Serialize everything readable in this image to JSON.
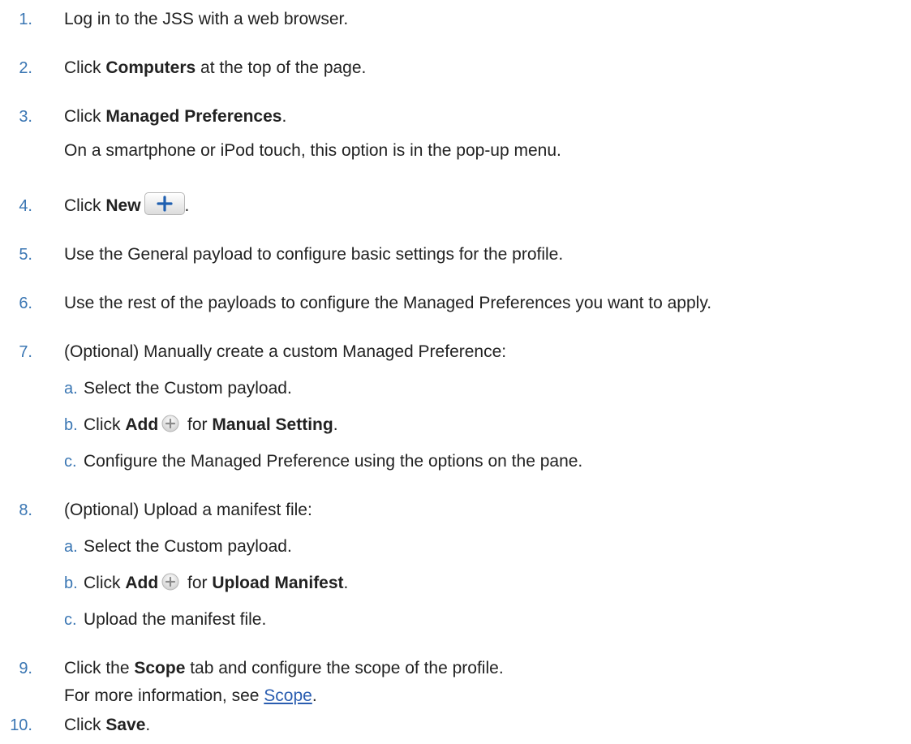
{
  "steps": [
    {
      "num": "1.",
      "text": "Log in to the JSS with a web browser."
    },
    {
      "num": "2.",
      "pre": "Click ",
      "bold": "Computers",
      "post": " at the top of the page."
    },
    {
      "num": "3.",
      "pre": "Click ",
      "bold": "Managed Preferences",
      "post": ".",
      "note": "On a smartphone or iPod touch, this option is in the pop-up menu."
    },
    {
      "num": "4.",
      "pre": "Click ",
      "bold": "New",
      "post": "."
    },
    {
      "num": "5.",
      "text": "Use the General payload to configure basic settings for the profile."
    },
    {
      "num": "6.",
      "text": "Use the rest of the payloads to configure the Managed Preferences you want to apply."
    },
    {
      "num": "7.",
      "text": "(Optional) Manually create a custom Managed Preference:",
      "sub": [
        {
          "num": "a.",
          "text": "Select the Custom payload."
        },
        {
          "num": "b.",
          "pre": "Click ",
          "bold": "Add",
          "mid": " for ",
          "bold2": "Manual Setting",
          "post": "."
        },
        {
          "num": "c.",
          "text": "Configure the Managed Preference using the options on the pane."
        }
      ]
    },
    {
      "num": "8.",
      "text": "(Optional) Upload a manifest file:",
      "sub": [
        {
          "num": "a.",
          "text": "Select the Custom payload."
        },
        {
          "num": "b.",
          "pre": "Click ",
          "bold": "Add",
          "mid": " for ",
          "bold2": "Upload Manifest",
          "post": "."
        },
        {
          "num": "c.",
          "text": "Upload the manifest file."
        }
      ]
    },
    {
      "num": "9.",
      "pre": "Click the ",
      "bold": "Scope",
      "post": " tab and configure the scope of the profile.",
      "note_pre": "For more information, see ",
      "note_link": "Scope",
      "note_post": "."
    },
    {
      "num": "10.",
      "pre": "Click ",
      "bold": "Save",
      "post": "."
    }
  ],
  "colors": {
    "number": "#3a76b3",
    "link": "#2a5db0",
    "text": "#222222"
  },
  "icons": {
    "new_button_icon": "plus-icon",
    "add_icon": "add-circle-icon"
  }
}
